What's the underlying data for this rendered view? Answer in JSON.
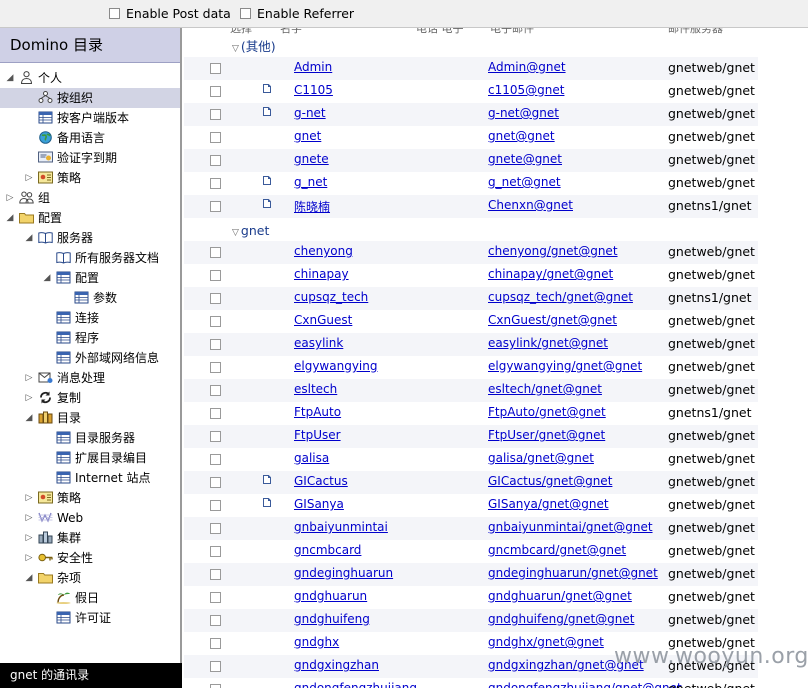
{
  "toolbar": {
    "post_data_label": "Enable Post data",
    "referrer_label": "Enable Referrer"
  },
  "sidebar": {
    "title": "Domino 目录",
    "status": "gnet 的通讯录",
    "items": [
      {
        "label": "个人",
        "level": 0,
        "twisty": "open",
        "icon": "person-icon"
      },
      {
        "label": "按组织",
        "level": 1,
        "twisty": "",
        "icon": "org-icon",
        "selected": true
      },
      {
        "label": "按客户端版本",
        "level": 1,
        "twisty": "",
        "icon": "view-icon"
      },
      {
        "label": "备用语言",
        "level": 1,
        "twisty": "",
        "icon": "globe-icon"
      },
      {
        "label": "验证字到期",
        "level": 1,
        "twisty": "",
        "icon": "certificate-icon"
      },
      {
        "label": "策略",
        "level": 1,
        "twisty": "closed",
        "icon": "policy-icon"
      },
      {
        "label": "组",
        "level": 0,
        "twisty": "closed",
        "icon": "group-icon"
      },
      {
        "label": "配置",
        "level": 0,
        "twisty": "open",
        "icon": "folder-icon"
      },
      {
        "label": "服务器",
        "level": 1,
        "twisty": "open",
        "icon": "book-icon"
      },
      {
        "label": "所有服务器文档",
        "level": 2,
        "twisty": "",
        "icon": "book-icon"
      },
      {
        "label": "配置",
        "level": 2,
        "twisty": "open",
        "icon": "view-icon"
      },
      {
        "label": "参数",
        "level": 3,
        "twisty": "",
        "icon": "view-icon"
      },
      {
        "label": "连接",
        "level": 2,
        "twisty": "",
        "icon": "view-icon"
      },
      {
        "label": "程序",
        "level": 2,
        "twisty": "",
        "icon": "view-icon"
      },
      {
        "label": "外部域网络信息",
        "level": 2,
        "twisty": "",
        "icon": "view-icon"
      },
      {
        "label": "消息处理",
        "level": 1,
        "twisty": "closed",
        "icon": "message-icon"
      },
      {
        "label": "复制",
        "level": 1,
        "twisty": "closed",
        "icon": "replicate-icon"
      },
      {
        "label": "目录",
        "level": 1,
        "twisty": "open",
        "icon": "directory-icon"
      },
      {
        "label": "目录服务器",
        "level": 2,
        "twisty": "",
        "icon": "view-icon"
      },
      {
        "label": "扩展目录编目",
        "level": 2,
        "twisty": "",
        "icon": "view-icon"
      },
      {
        "label": "Internet 站点",
        "level": 2,
        "twisty": "",
        "icon": "view-icon"
      },
      {
        "label": "策略",
        "level": 1,
        "twisty": "closed",
        "icon": "policy-icon"
      },
      {
        "label": "Web",
        "level": 1,
        "twisty": "closed",
        "icon": "web-icon"
      },
      {
        "label": "集群",
        "level": 1,
        "twisty": "closed",
        "icon": "cluster-icon"
      },
      {
        "label": "安全性",
        "level": 1,
        "twisty": "closed",
        "icon": "key-icon"
      },
      {
        "label": "杂项",
        "level": 1,
        "twisty": "open",
        "icon": "folder-icon"
      },
      {
        "label": "假日",
        "level": 2,
        "twisty": "",
        "icon": "holiday-icon"
      },
      {
        "label": "许可证",
        "level": 2,
        "twisty": "",
        "icon": "view-icon"
      }
    ]
  },
  "main": {
    "columns": [
      "选择",
      "名字",
      "电话 电子",
      "电子邮件",
      "邮件服务器"
    ],
    "groups": [
      {
        "name": "(其他)",
        "rows": [
          {
            "name": "Admin",
            "email": "Admin@gnet",
            "server": "gnetweb/gnet",
            "doc": false
          },
          {
            "name": "C1105",
            "email": "c1105@gnet",
            "server": "gnetweb/gnet",
            "doc": true
          },
          {
            "name": "g-net",
            "email": "g-net@gnet",
            "server": "gnetweb/gnet",
            "doc": true
          },
          {
            "name": "gnet",
            "email": "gnet@gnet",
            "server": "gnetweb/gnet",
            "doc": false
          },
          {
            "name": "gnete",
            "email": "gnete@gnet",
            "server": "gnetweb/gnet",
            "doc": false
          },
          {
            "name": "g_net",
            "email": "g_net@gnet",
            "server": "gnetweb/gnet",
            "doc": true
          },
          {
            "name": "陈晓楠",
            "email": "Chenxn@gnet",
            "server": "gnetns1/gnet",
            "doc": true
          }
        ]
      },
      {
        "name": "gnet",
        "rows": [
          {
            "name": "chenyong",
            "email": "chenyong/gnet@gnet",
            "server": "gnetweb/gnet",
            "doc": false
          },
          {
            "name": "chinapay",
            "email": "chinapay/gnet@gnet",
            "server": "gnetweb/gnet",
            "doc": false
          },
          {
            "name": "cupsqz_tech",
            "email": "cupsqz_tech/gnet@gnet",
            "server": "gnetns1/gnet",
            "doc": false
          },
          {
            "name": "CxnGuest",
            "email": "CxnGuest/gnet@gnet",
            "server": "gnetweb/gnet",
            "doc": false
          },
          {
            "name": "easylink",
            "email": "easylink/gnet@gnet",
            "server": "gnetweb/gnet",
            "doc": false
          },
          {
            "name": "elgywangying",
            "email": "elgywangying/gnet@gnet",
            "server": "gnetweb/gnet",
            "doc": false
          },
          {
            "name": "esltech",
            "email": "esltech/gnet@gnet",
            "server": "gnetweb/gnet",
            "doc": false
          },
          {
            "name": "FtpAuto",
            "email": "FtpAuto/gnet@gnet",
            "server": "gnetns1/gnet",
            "doc": false
          },
          {
            "name": "FtpUser",
            "email": "FtpUser/gnet@gnet",
            "server": "gnetweb/gnet",
            "doc": false
          },
          {
            "name": "galisa",
            "email": "galisa/gnet@gnet",
            "server": "gnetweb/gnet",
            "doc": false
          },
          {
            "name": "GICactus",
            "email": "GICactus/gnet@gnet",
            "server": "gnetweb/gnet",
            "doc": true
          },
          {
            "name": "GISanya",
            "email": "GISanya/gnet@gnet",
            "server": "gnetweb/gnet",
            "doc": true
          },
          {
            "name": "gnbaiyunmintai",
            "email": "gnbaiyunmintai/gnet@gnet",
            "server": "gnetweb/gnet",
            "doc": false
          },
          {
            "name": "gncmbcard",
            "email": "gncmbcard/gnet@gnet",
            "server": "gnetweb/gnet",
            "doc": false
          },
          {
            "name": "gndeginghuarun",
            "email": "gndeginghuarun/gnet@gnet",
            "server": "gnetweb/gnet",
            "doc": false
          },
          {
            "name": "gndghuarun",
            "email": "gndghuarun/gnet@gnet",
            "server": "gnetweb/gnet",
            "doc": false
          },
          {
            "name": "gndghuifeng",
            "email": "gndghuifeng/gnet@gnet",
            "server": "gnetweb/gnet",
            "doc": false
          },
          {
            "name": "gndghx",
            "email": "gndghx/gnet@gnet",
            "server": "gnetweb/gnet",
            "doc": false
          },
          {
            "name": "gndgxingzhan",
            "email": "gndgxingzhan/gnet@gnet",
            "server": "gnetweb/gnet",
            "doc": false
          },
          {
            "name": "gndongfengzhujiang",
            "email": "gndongfengzhujiang/gnet@gnet",
            "server": "gnetweb/gnet",
            "doc": false
          }
        ]
      }
    ]
  },
  "watermark": "www.wooyun.org"
}
